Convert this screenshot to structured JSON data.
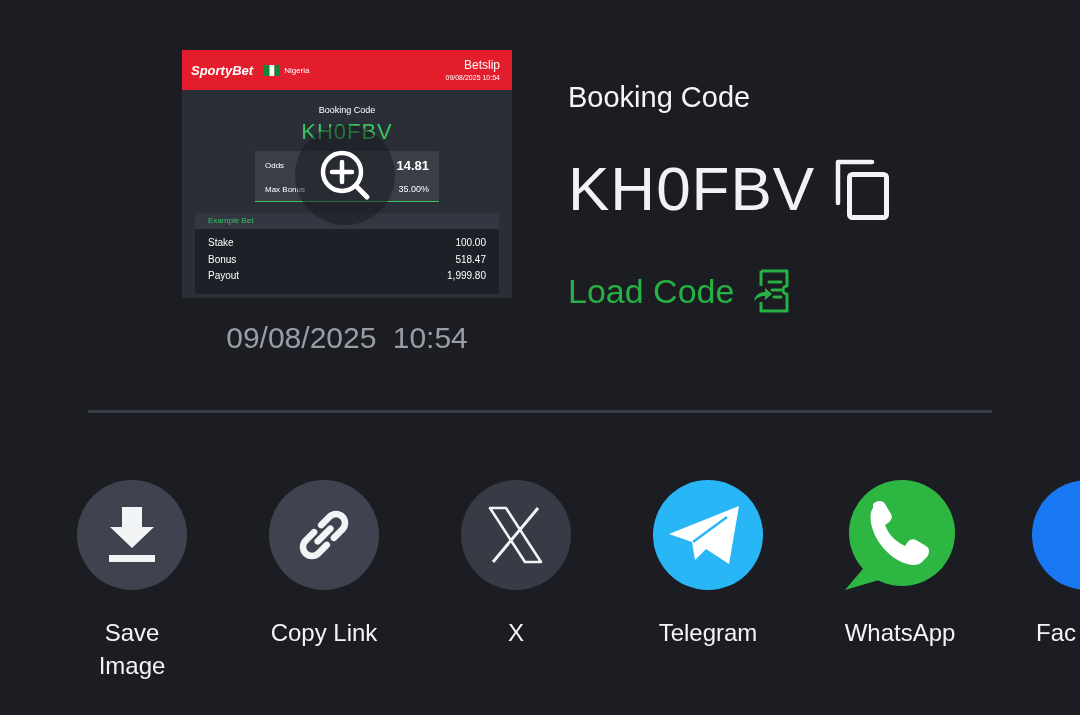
{
  "preview": {
    "betslip": {
      "brand": "SportyBet",
      "country": "Nigeria",
      "title": "Betslip",
      "datetime": "09/08/2025 10:54",
      "booking_label": "Booking Code",
      "booking_code": "KH0FBV",
      "summary": [
        {
          "label": "Odds",
          "value": "14.81"
        },
        {
          "label": "Max Bonus",
          "value": "35.00%"
        }
      ],
      "example": {
        "title": "Example Bet",
        "rows": [
          {
            "label": "Stake",
            "value": "100.00"
          },
          {
            "label": "Bonus",
            "value": "518.47"
          },
          {
            "label": "Payout",
            "value": "1,999.80"
          }
        ]
      }
    },
    "date": "09/08/2025 10:54"
  },
  "booking": {
    "label": "Booking Code",
    "code": "KH0FBV",
    "load_button": "Load Code"
  },
  "share_options": [
    {
      "label": "Save Image",
      "kind": "download"
    },
    {
      "label": "Copy Link",
      "kind": "link"
    },
    {
      "label": "X",
      "kind": "x"
    },
    {
      "label": "Telegram",
      "kind": "telegram"
    },
    {
      "label": "WhatsApp",
      "kind": "whatsapp"
    },
    {
      "label": "Fac",
      "kind": "disc"
    }
  ]
}
